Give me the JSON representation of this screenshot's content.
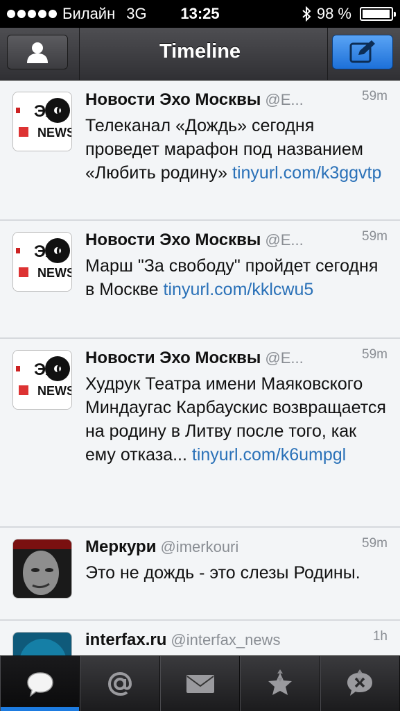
{
  "status_bar": {
    "carrier": "Билайн",
    "network": "3G",
    "time": "13:25",
    "battery": "98 %"
  },
  "nav": {
    "title": "Timeline",
    "left_icon": "accounts-icon",
    "right_icon": "compose-icon"
  },
  "tweets": [
    {
      "name": "Новости Эхо Москвы",
      "handle": "@E...",
      "time": "59m",
      "text": "Телеканал «Дождь» сегодня проведет марафон под названием «Любить родину»",
      "link": "tinyurl.com/k3ggvtp",
      "avatar": "echo-news-logo"
    },
    {
      "name": "Новости Эхо Москвы",
      "handle": "@E...",
      "time": "59m",
      "text": "Марш \"За свободу\" пройдет сегодня в Москве",
      "link": "tinyurl.com/kklcwu5",
      "avatar": "echo-news-logo"
    },
    {
      "name": "Новости Эхо Москвы",
      "handle": "@E...",
      "time": "59m",
      "text": "Худрук Театра имени Маяковского Миндаугас Карбаускис возвращается на родину в Литву после того, как ему отказа...",
      "link": "tinyurl.com/k6umpgl",
      "avatar": "echo-news-logo"
    },
    {
      "name": "Меркури",
      "handle": "@imerkouri",
      "time": "59m",
      "text": "Это не дождь - это слезы Родины.",
      "link": "",
      "avatar": "user-photo"
    },
    {
      "name": "interfax.ru",
      "handle": "@interfax_news",
      "time": "1h",
      "text": "",
      "link": "",
      "avatar": "interfax-logo"
    }
  ],
  "tabs": [
    {
      "icon": "speech-bubble-icon",
      "active": true
    },
    {
      "icon": "at-sign-icon",
      "active": false
    },
    {
      "icon": "envelope-icon",
      "active": false
    },
    {
      "icon": "star-icon",
      "active": false
    },
    {
      "icon": "mute-bubble-icon",
      "active": false
    }
  ],
  "logo_text": {
    "echo": "ЭХО",
    "news": "NEWS"
  },
  "colors": {
    "link": "#2a71b8",
    "compose_button": "#1d70d8",
    "tab_active_indicator": "#1d7be0"
  }
}
